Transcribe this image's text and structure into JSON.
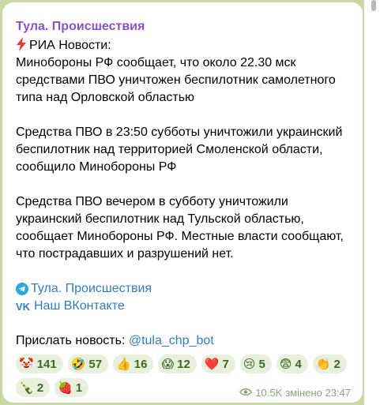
{
  "channel": {
    "title": "Тула. Происшествия"
  },
  "post": {
    "source_line": "РИА Новости:",
    "paragraphs": [
      "Минобороны РФ сообщает, что около 22.30 мск средствами ПВО уничтожен беспилотник самолетного типа над Орловской областью",
      "Средства ПВО в 23:50 субботы уничтожили украинский беспилотник над территорией Смоленской области, сообщило Минобороны РФ",
      "Средства ПВО вечером в субботу уничтожили украинский беспилотник над Тульской областью, сообщает Минобороны РФ. Местные власти сообщают, что пострадавших и разрушений нет."
    ],
    "links": {
      "telegram_label": "Тула. Происшествия",
      "vk_label": "Наш ВКонтакте"
    },
    "submit": {
      "prefix": "Прислать новость: ",
      "bot": "@tula_chp_bot"
    }
  },
  "reactions": [
    {
      "icon": "clown-face-icon",
      "emoji": "🤡",
      "count": "141"
    },
    {
      "icon": "rofl-icon",
      "emoji": "🤣",
      "count": "57"
    },
    {
      "icon": "thumbs-up-icon",
      "emoji": "👍",
      "count": "16"
    },
    {
      "icon": "scream-icon",
      "emoji": "😱",
      "count": "12"
    },
    {
      "icon": "heart-icon",
      "emoji": "❤️",
      "count": "7"
    },
    {
      "icon": "crying-face-icon",
      "emoji": "😢",
      "count": "5"
    },
    {
      "icon": "fearful-face-icon",
      "emoji": "😨",
      "count": "4"
    },
    {
      "icon": "clapping-icon",
      "emoji": "👏",
      "count": "2"
    },
    {
      "icon": "champagne-icon",
      "emoji": "🍾",
      "count": "2"
    },
    {
      "icon": "strawberry-icon",
      "emoji": "🍓",
      "count": "1"
    }
  ],
  "meta": {
    "views": "10.5K",
    "edited_time": "змінено 23:47"
  },
  "colors": {
    "channel_title": "#8b51c9",
    "link": "#2f7dc4",
    "reaction_bg": "#e7f0dc",
    "background": "#c9d9a6"
  }
}
